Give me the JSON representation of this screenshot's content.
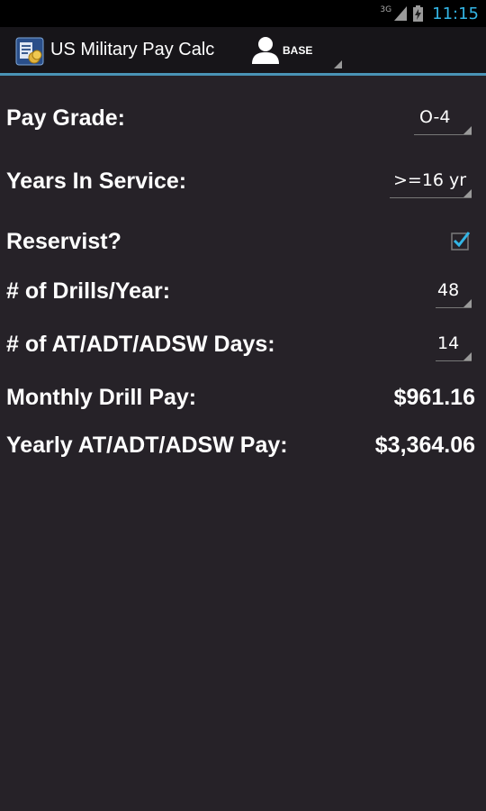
{
  "status_bar": {
    "network_type": "3G",
    "time": "11:15",
    "clock_color": "#33b5e5",
    "icons": [
      "signal-icon",
      "battery-icon"
    ]
  },
  "action_bar": {
    "app_icon": "app-icon",
    "title": "US Military Pay Calc",
    "profile_icon": "user-icon",
    "profile_label": "BASE",
    "divider_color": "#4a94b6"
  },
  "form": {
    "pay_grade": {
      "label": "Pay Grade:",
      "value": "O-4"
    },
    "years_in_service": {
      "label": "Years In Service:",
      "value": ">=16 yr"
    },
    "reservist": {
      "label": "Reservist?",
      "checked": true,
      "check_color": "#33b5e5"
    },
    "drills_per_year": {
      "label": "# of Drills/Year:",
      "value": "48"
    },
    "at_days": {
      "label": "# of AT/ADT/ADSW Days:",
      "value": "14"
    }
  },
  "results": {
    "monthly_drill_pay": {
      "label": "Monthly Drill Pay:",
      "value": "$961.16"
    },
    "yearly_at_pay": {
      "label": "Yearly AT/ADT/ADSW Pay:",
      "value": "$3,364.06"
    }
  }
}
